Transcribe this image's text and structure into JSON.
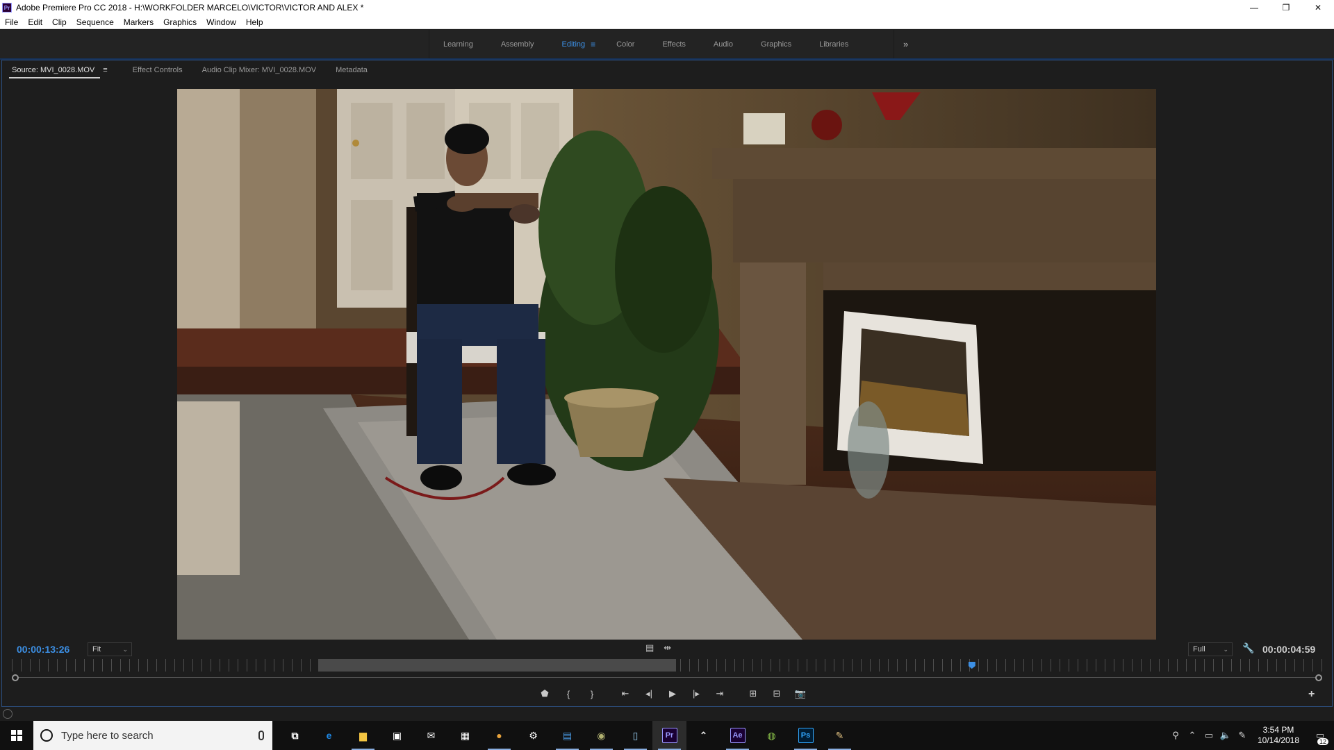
{
  "window": {
    "title": "Adobe Premiere Pro CC 2018 - H:\\WORKFOLDER MARCELO\\VICTOR\\VICTOR AND ALEX *",
    "app_icon_label": "Pr",
    "minimize": "—",
    "restore": "❐",
    "close": "✕"
  },
  "menu": [
    "File",
    "Edit",
    "Clip",
    "Sequence",
    "Markers",
    "Graphics",
    "Window",
    "Help"
  ],
  "workspaces": {
    "tabs": [
      "Learning",
      "Assembly",
      "Editing",
      "Color",
      "Effects",
      "Audio",
      "Graphics",
      "Libraries"
    ],
    "active": "Editing",
    "menu_glyph": "≡",
    "more_glyph": "»"
  },
  "panel": {
    "tabs": [
      "Source: MVI_0028.MOV",
      "Effect Controls",
      "Audio Clip Mixer: MVI_0028.MOV",
      "Metadata"
    ],
    "active_tab": "Source: MVI_0028.MOV",
    "tab_menu_glyph": "≡"
  },
  "monitor": {
    "timecode_current": "00:00:13:26",
    "timecode_duration": "00:00:04:59",
    "zoom": "Fit",
    "resolution": "Full",
    "playhead_fraction": 0.73,
    "in_fraction": 0.234,
    "out_fraction": 0.507
  },
  "taskbar": {
    "search_placeholder": "Type here to search",
    "clock_time": "3:54 PM",
    "clock_date": "10/14/2018",
    "notification_count": "12",
    "apps": [
      {
        "name": "task-view",
        "glyph": "⧉",
        "color": "#ffffff"
      },
      {
        "name": "edge",
        "glyph": "e",
        "color": "#1e88e5"
      },
      {
        "name": "file-explorer",
        "glyph": "▆",
        "color": "#f4c542"
      },
      {
        "name": "store",
        "glyph": "▣",
        "color": "#ffffff"
      },
      {
        "name": "mail",
        "glyph": "✉",
        "color": "#ffffff"
      },
      {
        "name": "calculator",
        "glyph": "▦",
        "color": "#ffffff"
      },
      {
        "name": "chrome",
        "glyph": "●",
        "color": "#e8a33c"
      },
      {
        "name": "settings",
        "glyph": "⚙",
        "color": "#ffffff"
      },
      {
        "name": "outlook",
        "glyph": "▤",
        "color": "#4a9be6"
      },
      {
        "name": "camera-app",
        "glyph": "◉",
        "color": "#b0b070"
      },
      {
        "name": "notepad",
        "glyph": "▯",
        "color": "#9ad0f5"
      },
      {
        "name": "premiere",
        "glyph": "Pr",
        "color": "#9999ff"
      },
      {
        "name": "arrow-app",
        "glyph": "⌃",
        "color": "#ffffff"
      },
      {
        "name": "after-effects",
        "glyph": "Ae",
        "color": "#9999ff"
      },
      {
        "name": "green-app",
        "glyph": "◍",
        "color": "#8bc34a"
      },
      {
        "name": "photoshop",
        "glyph": "Ps",
        "color": "#31a8ff"
      },
      {
        "name": "paint-app",
        "glyph": "✎",
        "color": "#e0c080"
      }
    ]
  },
  "colors": {
    "accent_blue": "#3c8fe4",
    "panel_bg": "#1d1d1d",
    "panel_border": "#2c4f80"
  }
}
